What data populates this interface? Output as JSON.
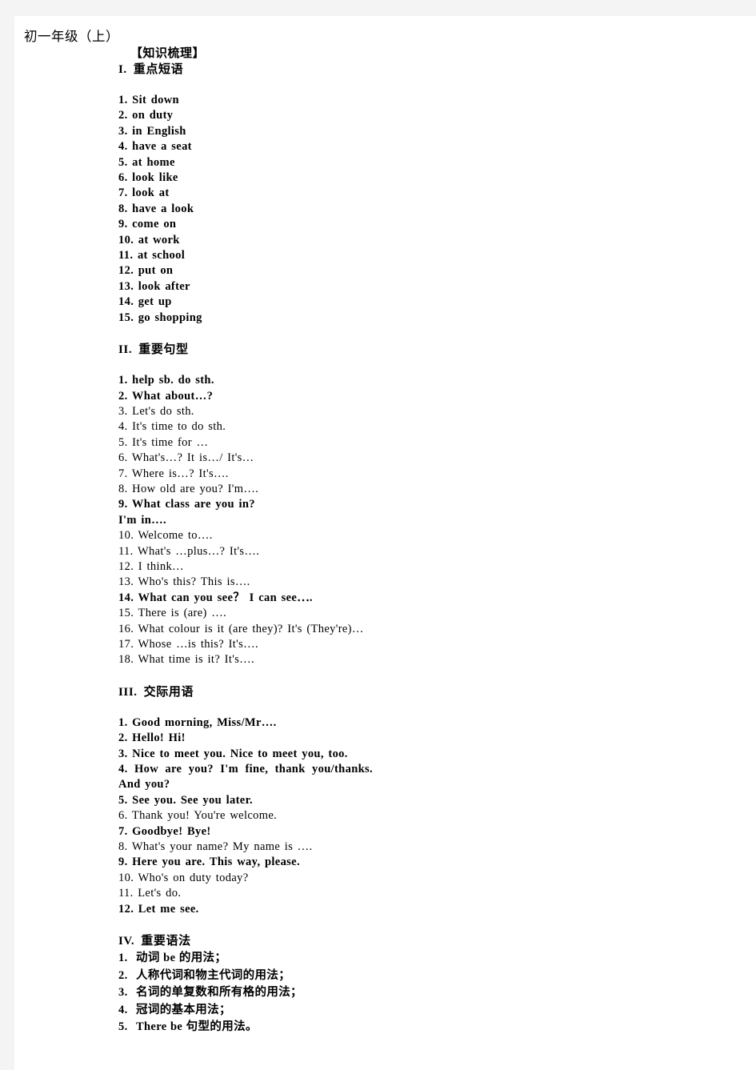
{
  "document": {
    "title": "初一年级（上）",
    "knowledge_heading": "【知识梳理】",
    "sections": [
      {
        "numeral": "I.",
        "heading": "重点短语",
        "items": [
          {
            "text": "1. Sit down",
            "bold": true
          },
          {
            "text": "2. on duty",
            "bold": true
          },
          {
            "text": "3. in English",
            "bold": true
          },
          {
            "text": "4. have a seat",
            "bold": true
          },
          {
            "text": "5. at home",
            "bold": true
          },
          {
            "text": "6. look like",
            "bold": true
          },
          {
            "text": "7. look at",
            "bold": true
          },
          {
            "text": "8. have a look",
            "bold": true
          },
          {
            "text": "9. come on",
            "bold": true
          },
          {
            "text": "10. at work",
            "bold": true
          },
          {
            "text": "11. at school",
            "bold": true
          },
          {
            "text": "12. put on",
            "bold": true
          },
          {
            "text": "13. look after",
            "bold": true
          },
          {
            "text": "14. get up",
            "bold": true
          },
          {
            "text": "15. go shopping",
            "bold": true
          }
        ]
      },
      {
        "numeral": "II.",
        "heading": "重要句型",
        "items": [
          {
            "text": "1. help sb. do sth.",
            "bold": true
          },
          {
            "text": "2. What about…?",
            "bold": true
          },
          {
            "text": "3. Let's do sth.",
            "bold": false
          },
          {
            "text": "4. It's time to do sth.",
            "bold": false
          },
          {
            "text": "5. It's time for …",
            "bold": false
          },
          {
            "text": "6. What's…? It is…/ It's…",
            "bold": false
          },
          {
            "text": "7. Where is…? It's….",
            "bold": false
          },
          {
            "text": "8. How old are you? I'm….",
            "bold": false
          },
          {
            "text": "9. What class are you in?",
            "bold": true
          },
          {
            "text": "I'm in….",
            "bold": true
          },
          {
            "text": "10. Welcome to….",
            "bold": false
          },
          {
            "text": "11. What's …plus…? It's….",
            "bold": false
          },
          {
            "text": "12. I think…",
            "bold": false
          },
          {
            "text": "13. Who's this? This is….",
            "bold": false
          },
          {
            "text": "14. What can you see？ I can see⋯.",
            "bold": true
          },
          {
            "text": "15. There is (are) ….",
            "bold": false
          },
          {
            "text": "16. What colour is it (are they)? It's (They're)…",
            "bold": false
          },
          {
            "text": "17. Whose …is this? It's….",
            "bold": false
          },
          {
            "text": "18. What time is it? It's….",
            "bold": false
          }
        ]
      },
      {
        "numeral": "III.",
        "heading": "交际用语",
        "items": [
          {
            "text": "1. Good morning, Miss/Mr….",
            "bold": true
          },
          {
            "text": "2. Hello! Hi!",
            "bold": true
          },
          {
            "text": "3. Nice to meet you. Nice to meet you, too.",
            "bold": true
          },
          {
            "text": "4. How are you? I'm fine, thank you/thanks. And you?",
            "bold": true
          },
          {
            "text": "5. See you. See you later.",
            "bold": true
          },
          {
            "text": "6. Thank you! You're welcome.",
            "bold": false
          },
          {
            "text": "7. Goodbye! Bye!",
            "bold": true
          },
          {
            "text": "8. What's your name? My name is ….",
            "bold": false
          },
          {
            "text": "9. Here you are. This way, please.",
            "bold": true
          },
          {
            "text": "10. Who's on duty today?",
            "bold": false
          },
          {
            "text": "11. Let's do.",
            "bold": false
          },
          {
            "text": "12. Let me see.",
            "bold": true
          }
        ]
      },
      {
        "numeral": "IV.",
        "heading": "重要语法",
        "items": [
          {
            "num": "1.",
            "text": "动词 be 的用法；"
          },
          {
            "num": "2.",
            "text": "人称代词和物主代词的用法；"
          },
          {
            "num": "3.",
            "text": "名词的单复数和所有格的用法；"
          },
          {
            "num": "4.",
            "text": "冠词的基本用法；"
          },
          {
            "num": "5.",
            "text": "There be 句型的用法。"
          }
        ]
      }
    ]
  }
}
